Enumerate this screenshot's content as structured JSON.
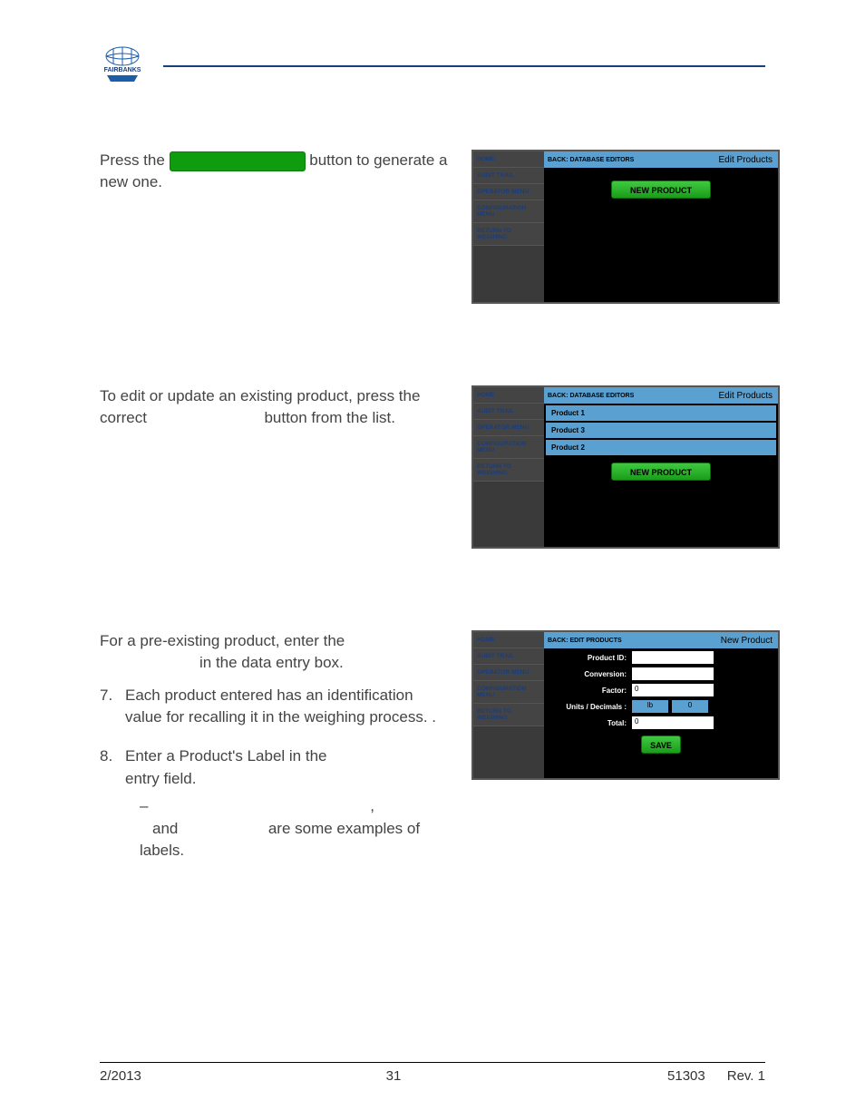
{
  "header": {
    "logo_text": "FAIRBANKS"
  },
  "section1": {
    "text_a": "Press the ",
    "text_b": " button to generate a new one.",
    "screenshot": {
      "sidebar": [
        "HOME",
        "AUDIT TRAIL",
        "OPERATOR MENU",
        "CONFIGURATION MENU",
        "RETURN TO WEIGHING"
      ],
      "back": "BACK: DATABASE EDITORS",
      "title": "Edit Products",
      "new_product_btn": "NEW PRODUCT"
    }
  },
  "section2": {
    "text_a": "To edit or update an existing product, press the correct",
    "text_b": "button from the list.",
    "screenshot": {
      "sidebar": [
        "HOME",
        "AUDIT TRAIL",
        "OPERATOR MENU",
        "CONFIGURATION MENU",
        "RETURN TO WEIGHING"
      ],
      "back": "BACK: DATABASE EDITORS",
      "title": "Edit Products",
      "products": [
        "Product 1",
        "Product 3",
        "Product 2"
      ],
      "new_product_btn": "NEW PRODUCT"
    }
  },
  "section3": {
    "text_a": "For a pre-existing product, enter the",
    "text_b": "in the data entry box.",
    "item7": "Each product entered has an identification value for recalling it in the weighing process. .",
    "item8_a": "Enter a Product's Label in the",
    "item8_b": "entry field.",
    "sub_dash": "–",
    "sub_comma": ",",
    "sub_and": "and",
    "sub_tail": "are some examples of labels.",
    "screenshot": {
      "sidebar": [
        "HOME",
        "AUDIT TRAIL",
        "OPERATOR MENU",
        "CONFIGURATION MENU",
        "RETURN TO WEIGHING"
      ],
      "back": "BACK: EDIT PRODUCTS",
      "title": "New Product",
      "fields": {
        "product_id": "Product ID:",
        "conversion": "Conversion:",
        "factor": "Factor:",
        "factor_val": "0",
        "units": "Units / Decimals :",
        "units_val1": "lb",
        "units_val2": "0",
        "total": "Total:",
        "total_val": "0"
      },
      "save_btn": "SAVE"
    }
  },
  "footer": {
    "left": "2/2013",
    "center": "31",
    "right_a": "51303",
    "right_b": "Rev. 1"
  }
}
